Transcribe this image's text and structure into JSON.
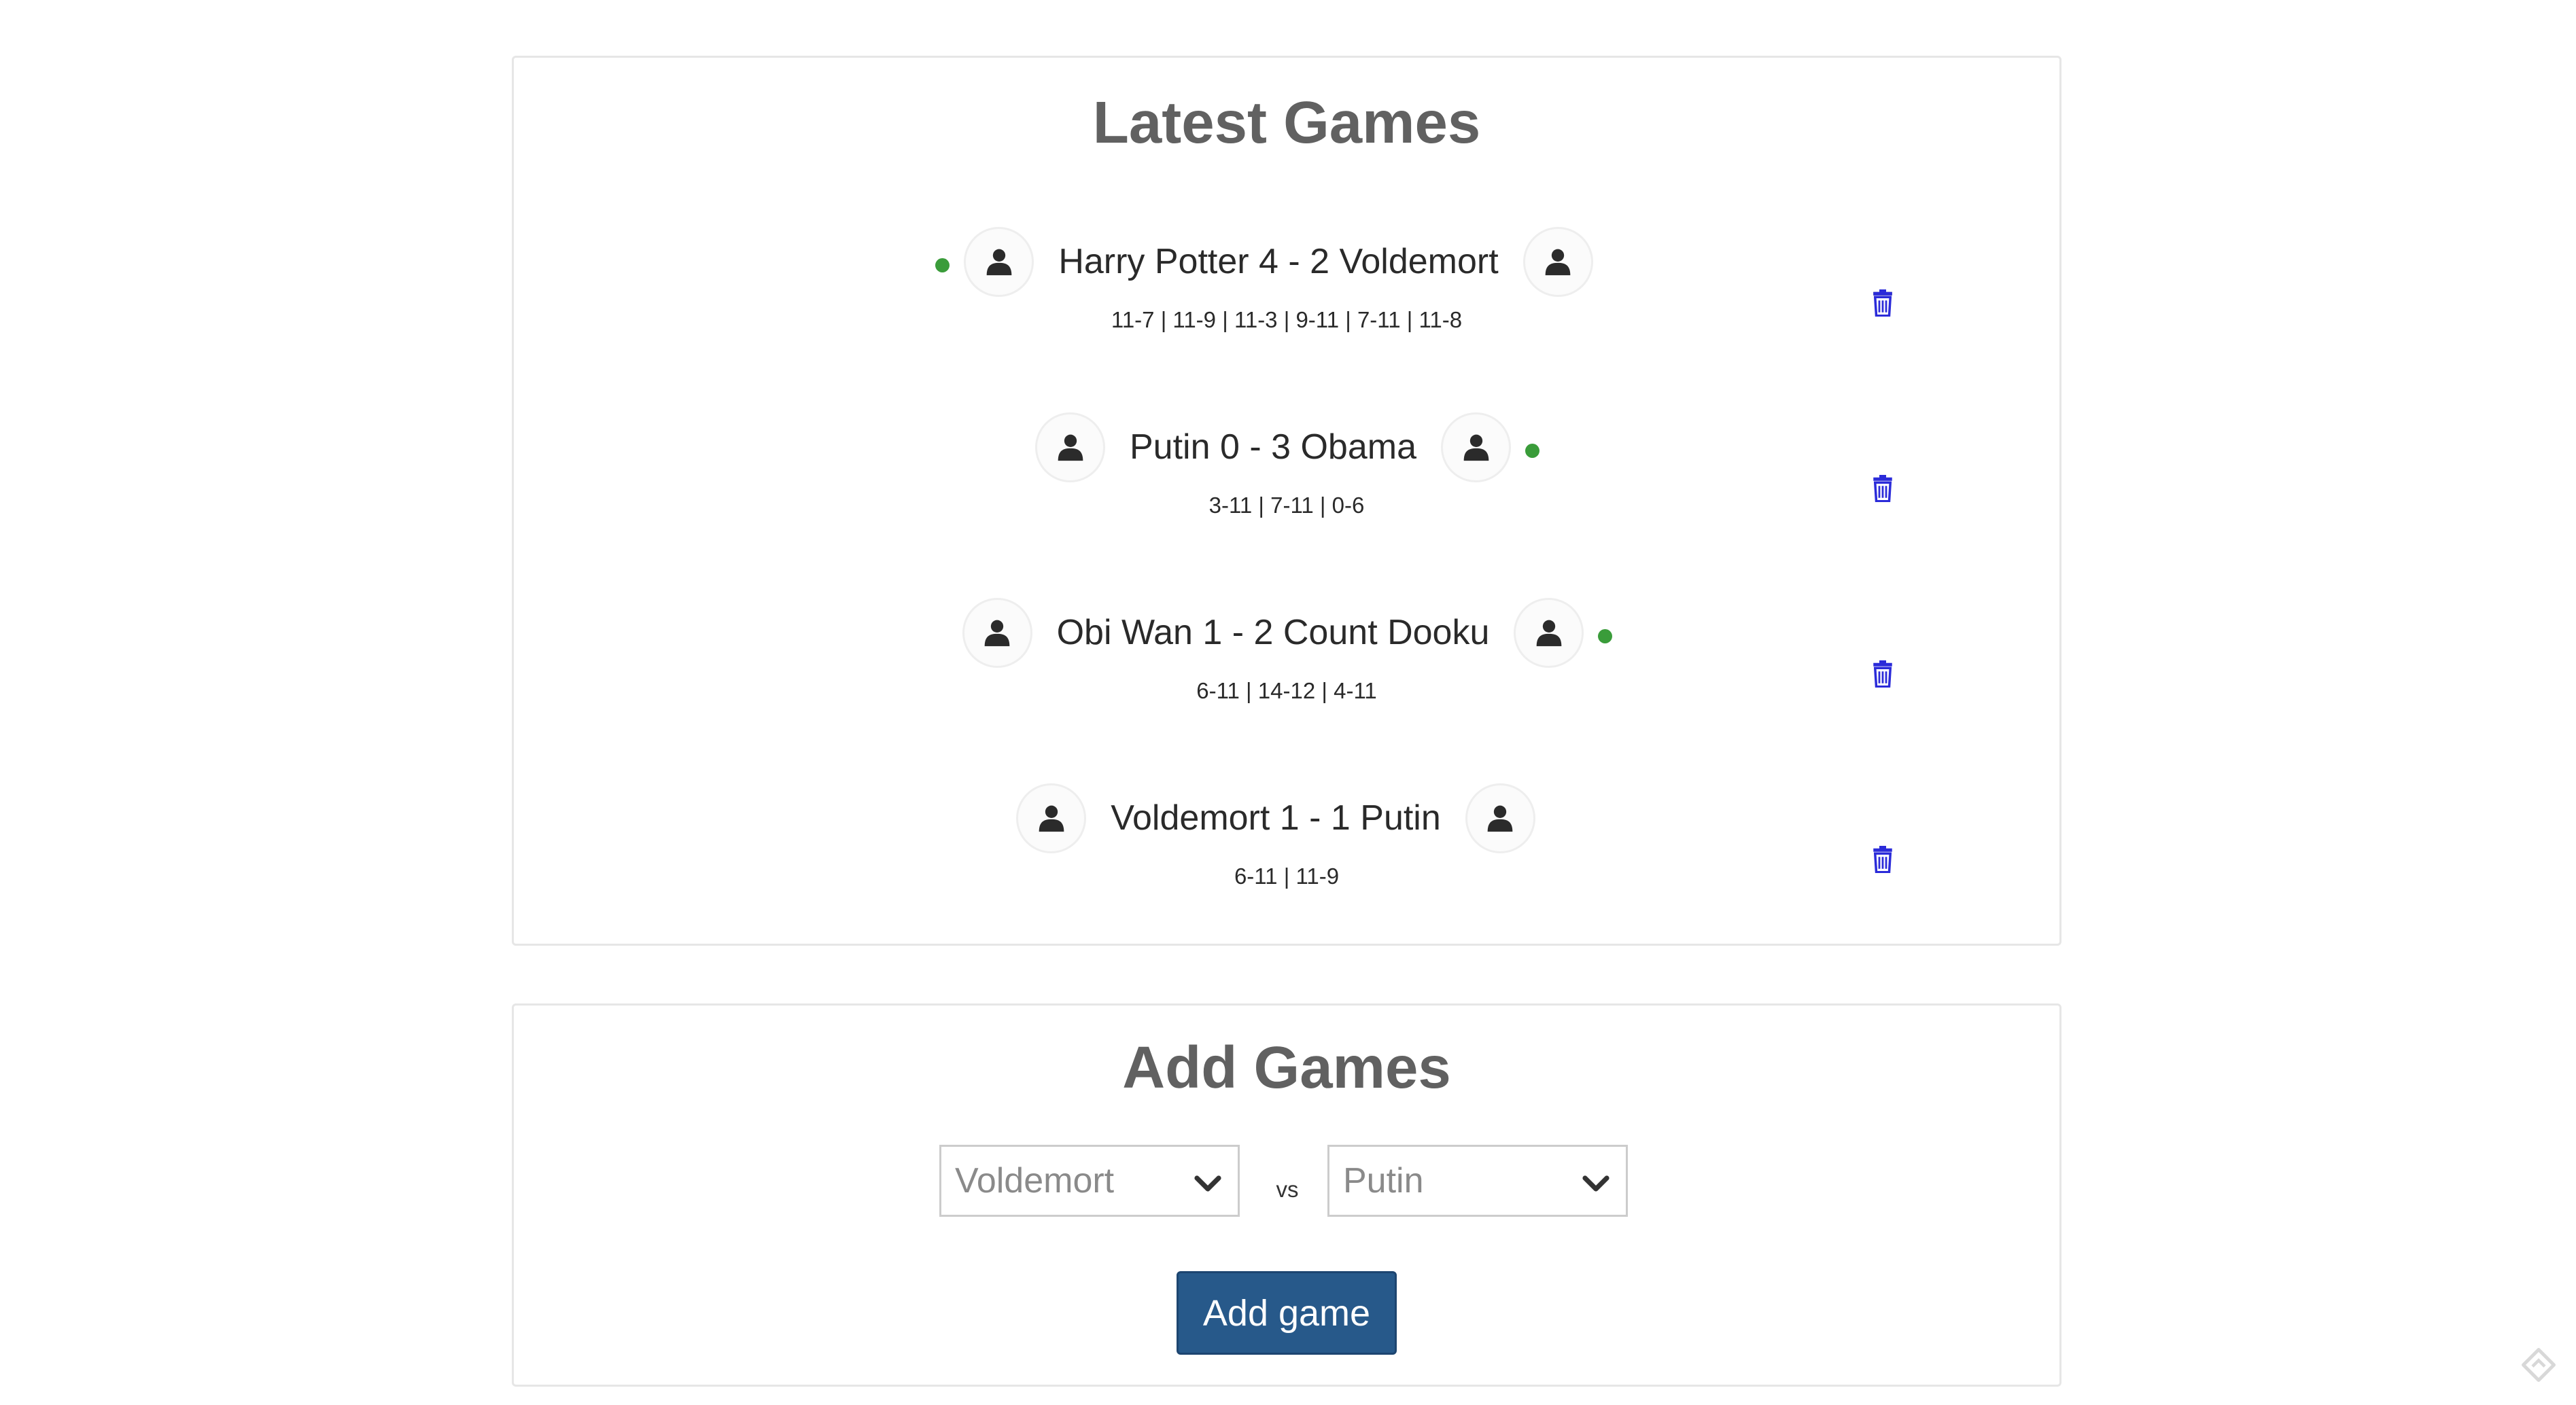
{
  "latest_games": {
    "title": "Latest Games",
    "games": [
      {
        "match": "Harry Potter 4 - 2 Voldemort",
        "sets": "11-7 | 11-9 | 11-3 | 9-11 | 7-11 | 11-8",
        "winner": "left"
      },
      {
        "match": "Putin 0 - 3 Obama",
        "sets": "3-11 | 7-11 | 0-6",
        "winner": "right"
      },
      {
        "match": "Obi Wan 1 - 2 Count Dooku",
        "sets": "6-11 | 14-12 | 4-11",
        "winner": "right"
      },
      {
        "match": "Voldemort 1 - 1 Putin",
        "sets": "6-11 | 11-9",
        "winner": "none"
      }
    ]
  },
  "add_games": {
    "title": "Add Games",
    "player_one": "Voldemort",
    "vs_label": "vs",
    "player_two": "Putin",
    "button_label": "Add game"
  },
  "icons": {
    "avatar": "user-silhouette-icon",
    "delete": "trash-icon",
    "winner_marker": "green-dot",
    "select_arrow": "chevron-down-icon"
  },
  "colors": {
    "winner_dot": "#3a9c3a",
    "trash": "#2b2bd9",
    "button": "#27598a",
    "title": "#616161"
  }
}
